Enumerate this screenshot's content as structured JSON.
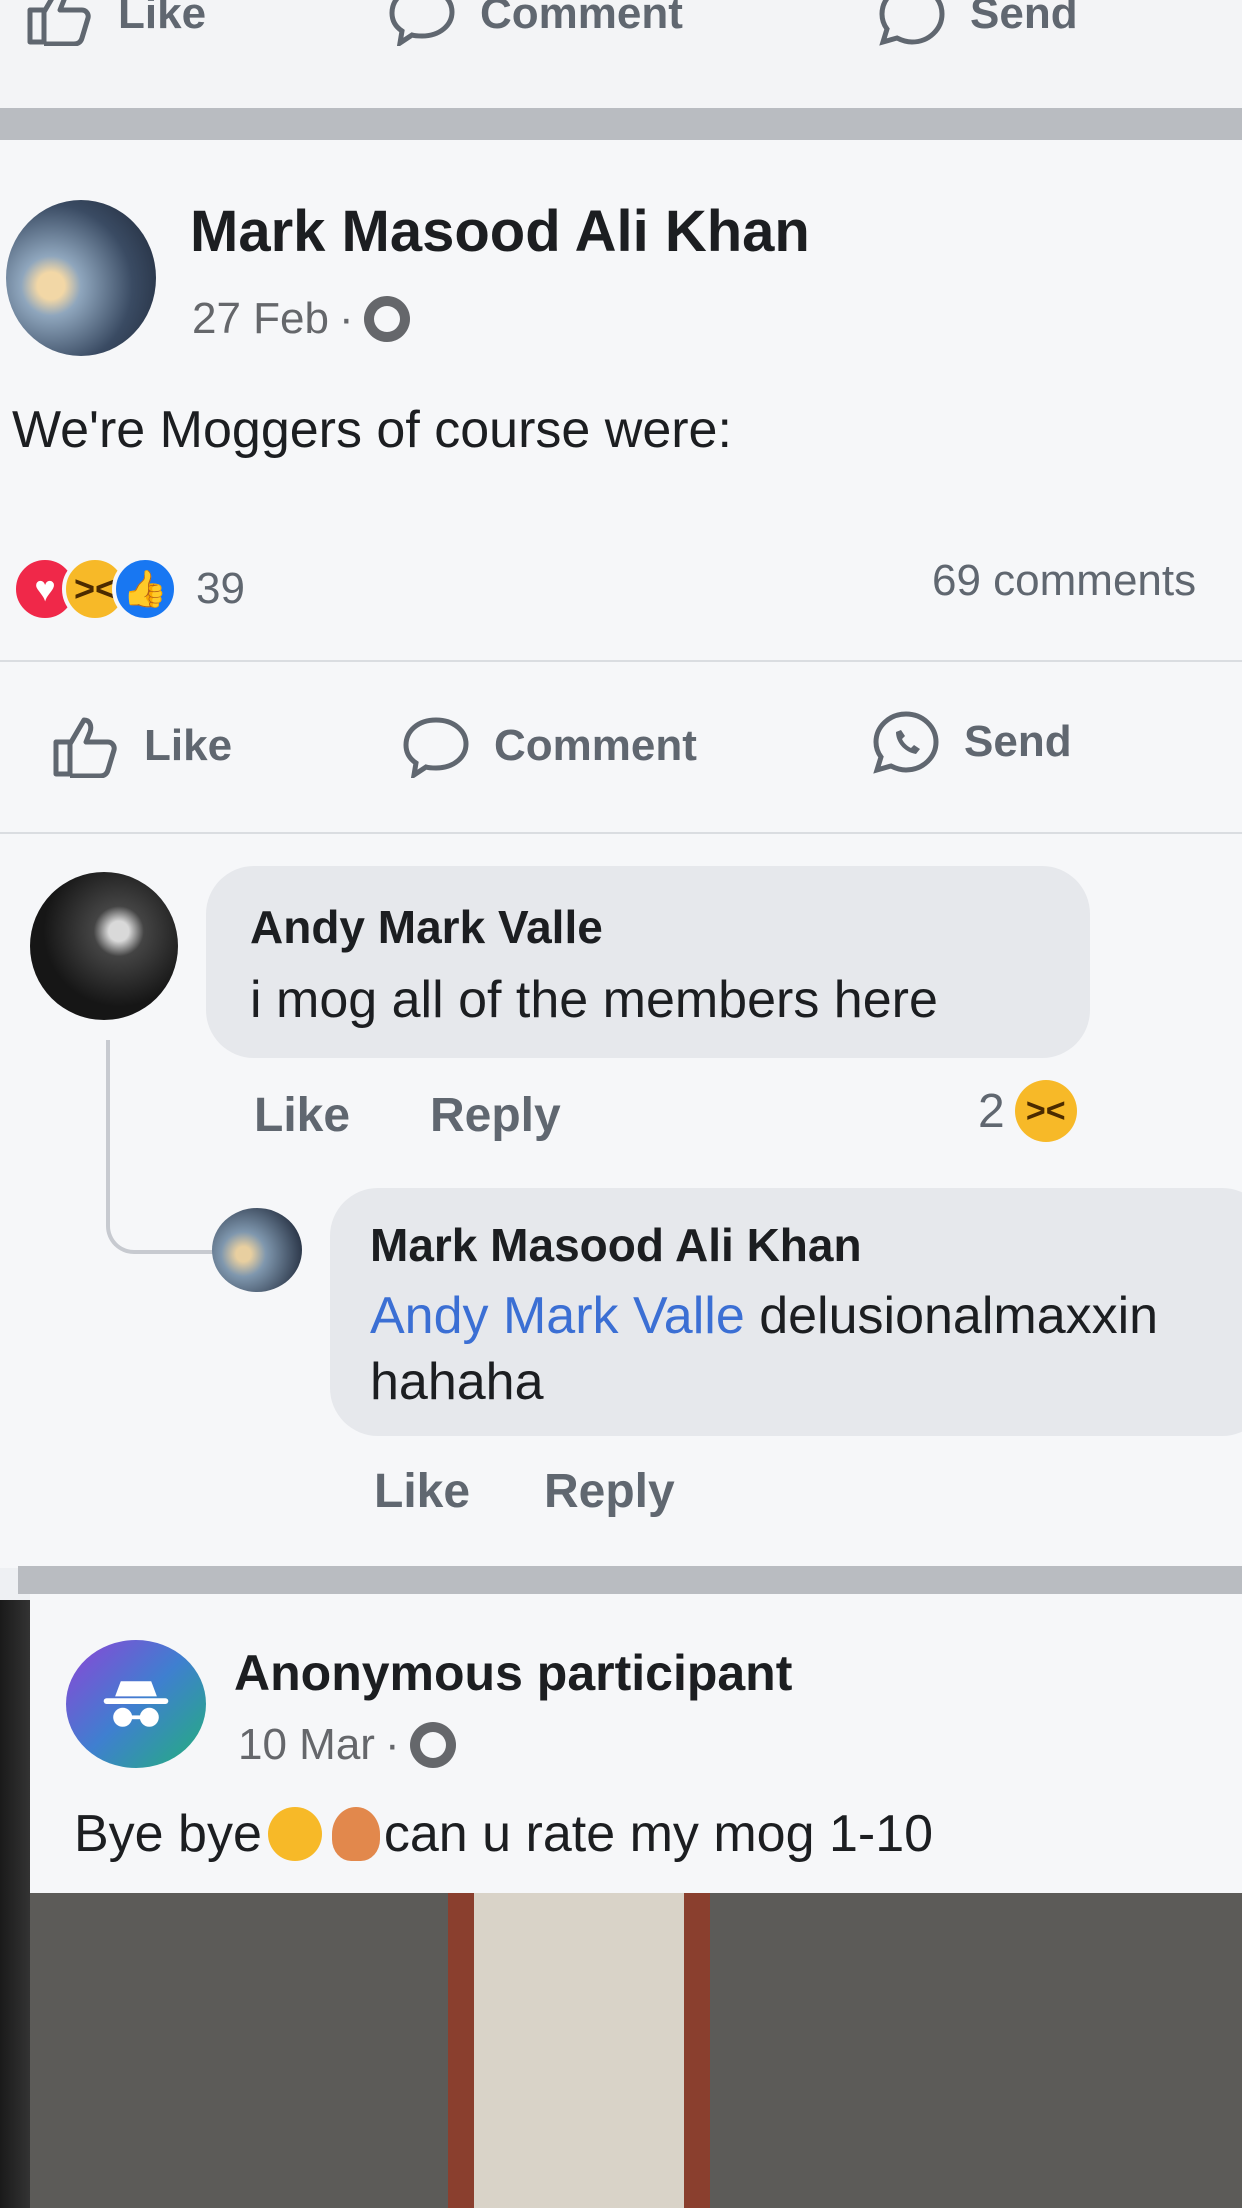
{
  "top_actions": {
    "like": "Like",
    "comment": "Comment",
    "send": "Send"
  },
  "post": {
    "author": "Mark Masood Ali Khan",
    "date": "27 Feb",
    "separator": "·",
    "text": "We're Moggers of course were:",
    "reaction_count": "39",
    "comments_count": "69 comments",
    "actions": {
      "like": "Like",
      "comment": "Comment",
      "send": "Send"
    }
  },
  "comments": [
    {
      "author": "Andy Mark Valle",
      "text": "i mog all of the members here",
      "like": "Like",
      "reply": "Reply",
      "reaction_count": "2"
    },
    {
      "author": "Mark Masood Ali Khan",
      "mention": "Andy Mark Valle",
      "text_after_mention": " delusionalmaxxin",
      "text_line2": "hahaha",
      "like": "Like",
      "reply": "Reply"
    }
  ],
  "post2": {
    "author": "Anonymous participant",
    "date": "10 Mar",
    "separator": "·",
    "text_prefix": "Bye bye",
    "text_suffix": " can u rate my mog 1-10"
  },
  "colors": {
    "accent_blue": "#1877f2",
    "mention_blue": "#3b6fd4",
    "heart_red": "#f02849",
    "haha_yellow": "#f7b928"
  }
}
